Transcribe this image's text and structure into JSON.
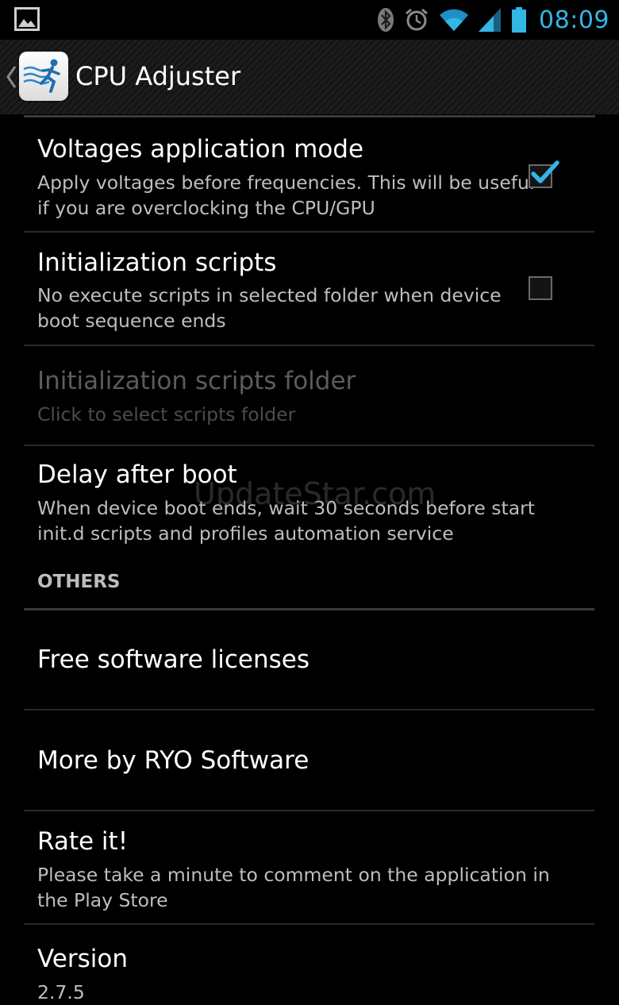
{
  "status_bar": {
    "time": "08:09",
    "icons": [
      "gallery-icon",
      "bluetooth-icon",
      "alarm-icon",
      "wifi-icon",
      "signal-icon",
      "battery-icon"
    ],
    "accent": "#33b5e5"
  },
  "action_bar": {
    "title": "CPU Adjuster"
  },
  "prefs": {
    "voltages": {
      "title": "Voltages application mode",
      "summary": "Apply voltages before frequencies. This will be useful if you are overclocking the CPU/GPU",
      "checked": true
    },
    "init_scripts": {
      "title": "Initialization scripts",
      "summary": "No execute scripts in selected folder when device boot sequence ends",
      "checked": false
    },
    "init_folder": {
      "title": "Initialization scripts folder",
      "summary": "Click to select scripts folder",
      "enabled": false
    },
    "delay": {
      "title": "Delay after boot",
      "summary": "When device boot ends, wait 30 seconds before start init.d scripts and profiles automation service"
    }
  },
  "others": {
    "header": "OTHERS",
    "licenses": {
      "title": "Free software licenses"
    },
    "more": {
      "title": "More by RYO Software"
    },
    "rate": {
      "title": "Rate it!",
      "summary": "Please take a minute to comment on the application in the Play Store"
    },
    "version": {
      "title": "Version",
      "summary": "2.7.5"
    }
  },
  "watermark": "UpdateStar.com"
}
